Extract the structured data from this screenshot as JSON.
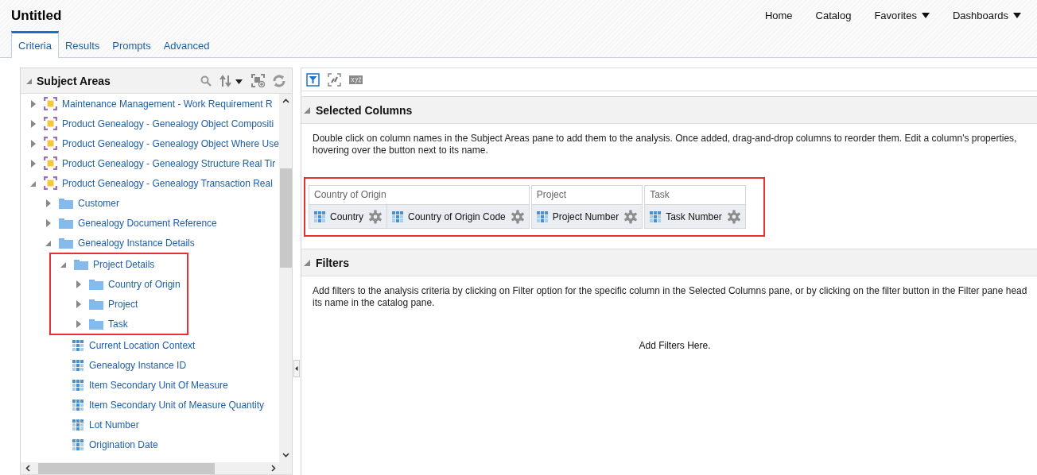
{
  "page": {
    "title": "Untitled"
  },
  "nav": [
    {
      "label": "Home",
      "menu": false
    },
    {
      "label": "Catalog",
      "menu": false
    },
    {
      "label": "Favorites",
      "menu": true
    },
    {
      "label": "Dashboards",
      "menu": true
    }
  ],
  "tabs": [
    {
      "label": "Criteria",
      "selected": true
    },
    {
      "label": "Results",
      "selected": false
    },
    {
      "label": "Prompts",
      "selected": false
    },
    {
      "label": "Advanced",
      "selected": false
    }
  ],
  "subject_areas": {
    "title": "Subject Areas",
    "expanded": true,
    "items": [
      {
        "kind": "subject-area",
        "label": "Maintenance Management - Work Requirement R",
        "expanded": false
      },
      {
        "kind": "subject-area",
        "label": "Product Genealogy - Genealogy Object Compositi",
        "expanded": false
      },
      {
        "kind": "subject-area",
        "label": "Product Genealogy - Genealogy Object Where Use",
        "expanded": false
      },
      {
        "kind": "subject-area",
        "label": "Product Genealogy - Genealogy Structure Real Tir",
        "expanded": false
      },
      {
        "kind": "subject-area",
        "label": "Product Genealogy - Genealogy Transaction Real",
        "expanded": true,
        "children": [
          {
            "kind": "folder",
            "label": "Customer",
            "expanded": false
          },
          {
            "kind": "folder",
            "label": "Genealogy Document Reference",
            "expanded": false
          },
          {
            "kind": "folder",
            "label": "Genealogy Instance Details",
            "expanded": true,
            "children": [
              {
                "kind": "folder",
                "label": "Project Details",
                "expanded": true,
                "highlighted": true,
                "children": [
                  {
                    "kind": "folder",
                    "label": "Country of Origin",
                    "expanded": false
                  },
                  {
                    "kind": "folder",
                    "label": "Project",
                    "expanded": false
                  },
                  {
                    "kind": "folder",
                    "label": "Task",
                    "expanded": false
                  }
                ]
              },
              {
                "kind": "column",
                "label": "Current Location Context"
              },
              {
                "kind": "column",
                "label": "Genealogy Instance ID"
              },
              {
                "kind": "column",
                "label": "Item Secondary Unit Of Measure"
              },
              {
                "kind": "column",
                "label": "Item Secondary Unit of Measure Quantity"
              },
              {
                "kind": "column",
                "label": "Lot Number"
              },
              {
                "kind": "column",
                "label": "Origination Date"
              }
            ]
          }
        ]
      }
    ]
  },
  "selected_columns": {
    "title": "Selected Columns",
    "expanded": true,
    "description": [
      "Double click on column names in the Subject Areas pane to add them to the analysis. Once added, drag-and-drop columns to reorder them. Edit a column's properties,",
      "hovering over the button next to its name."
    ],
    "highlighted": true,
    "groups": [
      {
        "label": "Country of Origin",
        "columns": [
          "Country",
          "Country of Origin Code"
        ]
      },
      {
        "label": "Project",
        "columns": [
          "Project Number"
        ]
      },
      {
        "label": "Task",
        "columns": [
          "Task Number"
        ]
      }
    ]
  },
  "filters": {
    "title": "Filters",
    "expanded": true,
    "description": [
      "Add filters to the analysis criteria by clicking on Filter option for the specific column in the Selected Columns pane, or by clicking on the filter button in the Filter pane head",
      "its name in the catalog pane."
    ],
    "drop_hint": "Add Filters Here."
  }
}
